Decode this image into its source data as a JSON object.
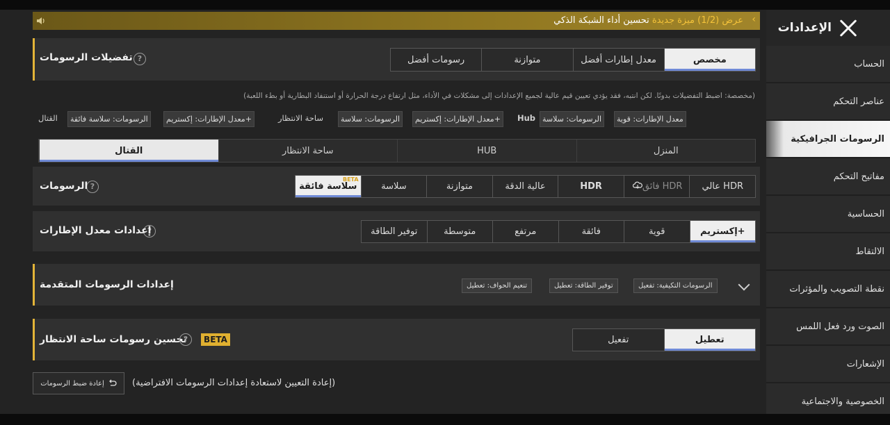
{
  "sidebar": {
    "title": "الإعدادات",
    "items": [
      {
        "label": "الحساب"
      },
      {
        "label": "عناصر التحكم"
      },
      {
        "label": "الرسومات الجرافيكية"
      },
      {
        "label": "مفاتيح التحكم"
      },
      {
        "label": "الحساسية"
      },
      {
        "label": "الالتقاط"
      },
      {
        "label": "نقطة التصويب والمؤثرات"
      },
      {
        "label": "الصوت ورد فعل اللمس"
      },
      {
        "label": "الإشعارات"
      },
      {
        "label": "الخصوصية والاجتماعية"
      }
    ],
    "active_index": 2
  },
  "notice": {
    "prefix": "عرض (1/2)",
    "tag": "ميزة جديدة",
    "text": "تحسين أداء الشبكة الذكي"
  },
  "graphics_prefs": {
    "label": "تفضيلات الرسومات",
    "options": [
      "مخصص",
      "معدل إطارات أفضل",
      "متوازنة",
      "رسومات أفضل"
    ],
    "selected": "مخصص",
    "description": "(مخصصة: اضبط التفضيلات بدونًا. لكن انتبه، فقد يؤدي تعيين قيم عالية لجميع الإعدادات إلى مشكلات في الأداء، مثل ارتفاع درجة الحرارة أو استنفاد البطارية أو بطء اللعبة)",
    "chips": {
      "hub_fps": "معدل الإطارات: قوية",
      "hub_gfx": "الرسومات: سلاسة",
      "hub_label": "Hub",
      "lobby_fps": "معدل الإطارات: إكستريم+",
      "lobby_gfx": "الرسومات: سلاسة",
      "lobby_label": "ساحة الانتظار",
      "battle_fps": "معدل الإطارات: إكستريم+",
      "battle_gfx": "الرسومات: سلاسة فائقة",
      "battle_label": "القتال"
    }
  },
  "mode_tabs": [
    "القتال",
    "ساحة الانتظار",
    "HUB",
    "المنزل"
  ],
  "mode_selected": "القتال",
  "graphics": {
    "label": "الرسومات",
    "options": [
      "سلاسة فائقة",
      "سلاسة",
      "متوازنة",
      "عالية الدقة",
      "HDR",
      "فائق HDR",
      "عالي HDR"
    ],
    "selected": "سلاسة فائقة",
    "beta_mini": "BETA"
  },
  "fps": {
    "label": "إعدادات معدل الإطارات",
    "options": [
      "توفير الطاقة",
      "متوسطة",
      "مرتفع",
      "فائقة",
      "قوية",
      "إكستريم+"
    ],
    "selected": "إكستريم+"
  },
  "advanced": {
    "label": "إعدادات الرسومات المتقدمة",
    "chips": [
      "تنعيم الحواف: تعطيل",
      "توفير الطاقة: تعطيل",
      "الرسومات التكيفية: تفعيل"
    ]
  },
  "lobby_enhance": {
    "label": "تحسين رسومات ساحة الانتظار",
    "badge": "BETA",
    "options": [
      "تفعيل",
      "تعطيل"
    ],
    "selected": "تعطيل"
  },
  "reset": {
    "button": "إعادة ضبط الرسومات",
    "text": "(إعادة التعيين لاستعادة إعدادات الرسومات الافتراضية)"
  },
  "icons": {
    "close": "close-icon",
    "speaker": "speaker-icon",
    "help": "help-icon",
    "chevron": "chevron-down-icon",
    "reset": "reset-icon",
    "cloud": "cloud-icon"
  },
  "colors": {
    "accent": "#e3b438",
    "selected_bg": "#eeeeee",
    "panel": "#303030",
    "background": "#232323"
  }
}
